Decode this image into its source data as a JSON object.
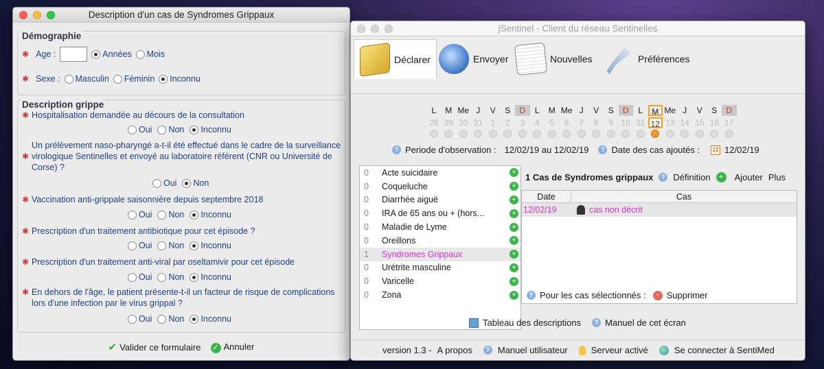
{
  "form_window": {
    "title": "Description d'un cas de Syndromes Grippaux",
    "demographie": {
      "section_title": "Démographie",
      "age_label": "Age :",
      "age_value": "",
      "age_units": [
        "Années",
        "Mois"
      ],
      "age_unit_selected": "Années",
      "sexe_label": "Sexe :",
      "sexe_options": [
        "Masculin",
        "Féminin",
        "Inconnu"
      ],
      "sexe_selected": "Inconnu"
    },
    "description": {
      "section_title": "Description grippe",
      "questions": [
        {
          "text": "Hospitalisation demandée au décours de la consultation",
          "options": [
            "Oui",
            "Non",
            "Inconnu"
          ],
          "selected": "Inconnu"
        },
        {
          "text": "Un prélèvement naso-pharyngé a-t-il été effectué dans le cadre de la surveillance virologique Sentinelles et envoyé au laboratoire référent (CNR ou Université de Corse) ?",
          "options": [
            "Oui",
            "Non"
          ],
          "selected": "Non"
        },
        {
          "text": "Vaccination anti-grippale saisonnière depuis septembre 2018",
          "options": [
            "Oui",
            "Non",
            "Inconnu"
          ],
          "selected": "Inconnu"
        },
        {
          "text": "Prescription d'un traitement antibiotique pour cet épisode ?",
          "options": [
            "Oui",
            "Non",
            "Inconnu"
          ],
          "selected": "Inconnu"
        },
        {
          "text": "Prescription d'un traitement anti-viral par oseltamivir pour cet épisode",
          "options": [
            "Oui",
            "Non",
            "Inconnu"
          ],
          "selected": "Inconnu"
        },
        {
          "text": "En dehors de l'âge, le patient présente-t-il un facteur de risque de complications lors d'une infection par le virus grippal ?",
          "options": [
            "Oui",
            "Non",
            "Inconnu"
          ],
          "selected": "Inconnu"
        }
      ]
    },
    "footer": {
      "validate_label": "Valider ce formulaire",
      "cancel_label": "Annuler"
    }
  },
  "main_window": {
    "title": "jSentinel - Client du réseau Sentinelles",
    "toolbar": [
      {
        "label": "Déclarer",
        "icon": "pencil-notepad-icon",
        "selected": true
      },
      {
        "label": "Envoyer",
        "icon": "globe-send-icon",
        "selected": false
      },
      {
        "label": "Nouvelles",
        "icon": "newspaper-icon",
        "selected": false
      },
      {
        "label": "Préférences",
        "icon": "tools-icon",
        "selected": false
      }
    ],
    "calendar": {
      "day_letters": [
        "L",
        "M",
        "Me",
        "J",
        "V",
        "S",
        "D",
        "L",
        "M",
        "Me",
        "J",
        "V",
        "S",
        "D",
        "L",
        "M",
        "Me",
        "J",
        "V",
        "S",
        "D"
      ],
      "dates": [
        "28",
        "29",
        "30",
        "31",
        "1",
        "2",
        "3",
        "4",
        "5",
        "6",
        "7",
        "8",
        "9",
        "10",
        "11",
        "12",
        "13",
        "14",
        "15",
        "16",
        "17"
      ],
      "current_index": 15
    },
    "observation": {
      "period_label": "Periode d'observation :",
      "period_value": "12/02/19 au 12/02/19",
      "added_label": "Date des cas ajoutés :",
      "added_value": "12/02/19"
    },
    "diseases": [
      {
        "count": "0",
        "name": "Acte suicidaire"
      },
      {
        "count": "0",
        "name": "Coqueluche"
      },
      {
        "count": "0",
        "name": "Diarrhée aiguë"
      },
      {
        "count": "0",
        "name": "IRA de 65 ans ou + (hors..."
      },
      {
        "count": "0",
        "name": "Maladie de Lyme"
      },
      {
        "count": "0",
        "name": "Oreillons"
      },
      {
        "count": "1",
        "name": "Syndromes Grippaux"
      },
      {
        "count": "0",
        "name": "Urétrite masculine"
      },
      {
        "count": "0",
        "name": "Varicelle"
      },
      {
        "count": "0",
        "name": "Zona"
      }
    ],
    "selected_disease_index": 6,
    "cases": {
      "header": "1 Cas de Syndromes grippaux",
      "definition_label": "Définition",
      "add_label": "Ajouter",
      "more_label": "Plus",
      "columns": [
        "Date",
        "Cas"
      ],
      "rows": [
        {
          "date": "12/02/19",
          "cas": "cas non décrit"
        }
      ]
    },
    "selected_actions": {
      "label": "Pour les cas sélectionnés :",
      "delete_label": "Supprimer"
    },
    "links": {
      "table_label": "Tableau des descriptions",
      "manual_label": "Manuel de cet écran"
    },
    "status": {
      "version": "version 1.3 -",
      "about": "A propos",
      "user_manual": "Manuel utilisateur",
      "server": "Serveur activé",
      "connect": "Se connecter à SentiMed"
    }
  }
}
